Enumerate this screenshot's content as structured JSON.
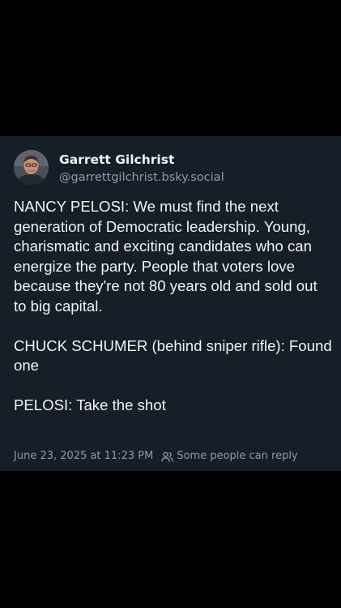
{
  "post": {
    "author": {
      "display_name": "Garrett Gilchrist",
      "handle": "@garrettgilchrist.bsky.social",
      "avatar_icon": "profile-photo"
    },
    "paragraphs": [
      "NANCY PELOSI: We must find the next generation of Democratic leadership. Young, charismatic and exciting candidates who can energize the party. People that voters love because they're not 80 years old and sold out to big capital.",
      "CHUCK SCHUMER (behind sniper rifle): Found one",
      "PELOSI: Take the shot"
    ],
    "timestamp": "June 23, 2025 at 11:23 PM",
    "reply_setting": "Some people can reply",
    "reply_icon": "people-icon"
  },
  "colors": {
    "background": "#000000",
    "card": "#161e27",
    "text": "#f1f3f5",
    "muted": "#8d9aab"
  }
}
